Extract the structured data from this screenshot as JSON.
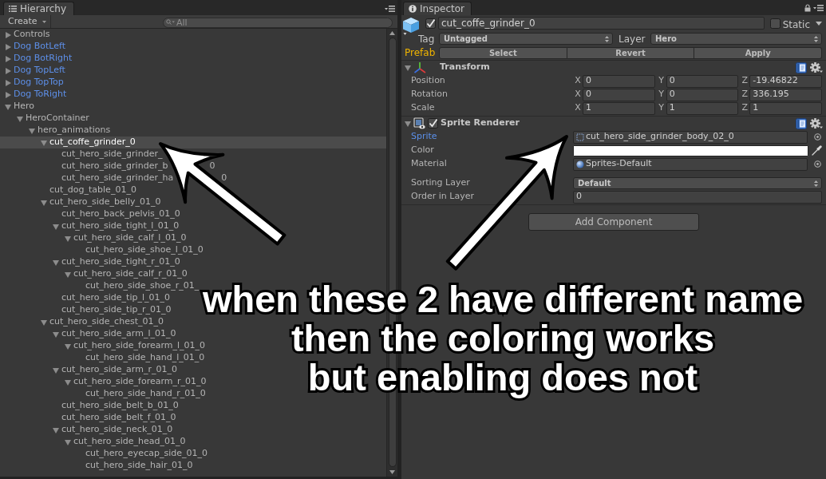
{
  "hierarchy": {
    "tab": "Hierarchy",
    "create_button": "Create",
    "search": {
      "placeholder": "All"
    },
    "items": [
      {
        "label": "Controls",
        "expanded": false,
        "prefab": false,
        "selected": false
      },
      {
        "label": "Dog BotLeft",
        "expanded": false,
        "prefab": true,
        "selected": false
      },
      {
        "label": "Dog BotRight",
        "expanded": false,
        "prefab": true,
        "selected": false
      },
      {
        "label": "Dog TopLeft",
        "expanded": false,
        "prefab": true,
        "selected": false
      },
      {
        "label": "Dog TopTop",
        "expanded": false,
        "prefab": true,
        "selected": false
      },
      {
        "label": "Dog ToRight",
        "expanded": false,
        "prefab": true,
        "selected": false
      },
      {
        "label": "Hero",
        "expanded": true,
        "prefab": false,
        "selected": false,
        "children": [
          {
            "label": "HeroContainer",
            "expanded": true,
            "selected": false,
            "children": [
              {
                "label": "hero_animations",
                "expanded": true,
                "selected": false,
                "children": [
                  {
                    "label": "cut_coffe_grinder_0",
                    "expanded": true,
                    "selected": true,
                    "children": [
                      {
                        "label": "cut_hero_side_grinder_",
                        "selected": false
                      },
                      {
                        "label": "cut_hero_side_grinder_b",
                        "text_after_arrow": "0",
                        "selected": false
                      },
                      {
                        "label": "cut_hero_side_grinder_ha",
                        "text_after_arrow": "0",
                        "selected": false
                      }
                    ]
                  },
                  {
                    "label": "cut_dog_table_01_0",
                    "selected": false
                  },
                  {
                    "label": "cut_hero_side_belly_01_0",
                    "expanded": true,
                    "selected": false,
                    "children": [
                      {
                        "label": "cut_hero_back_pelvis_01_0",
                        "selected": false
                      },
                      {
                        "label": "cut_hero_side_tight_l_01_0",
                        "expanded": true,
                        "selected": false,
                        "children": [
                          {
                            "label": "cut_hero_side_calf_l_01_0",
                            "expanded": true,
                            "selected": false,
                            "children": [
                              {
                                "label": "cut_hero_side_shoe_l_01_0",
                                "selected": false
                              }
                            ]
                          }
                        ]
                      },
                      {
                        "label": "cut_hero_side_tight_r_01_0",
                        "expanded": true,
                        "selected": false,
                        "children": [
                          {
                            "label": "cut_hero_side_calf_r_01_0",
                            "expanded": true,
                            "selected": false,
                            "children": [
                              {
                                "label": "cut_hero_side_shoe_r_01_",
                                "selected": false
                              }
                            ]
                          }
                        ]
                      },
                      {
                        "label": "cut_hero_side_tip_l_01_0",
                        "selected": false
                      },
                      {
                        "label": "cut_hero_side_tip_r_01_0",
                        "selected": false
                      }
                    ]
                  },
                  {
                    "label": "cut_hero_side_chest_01_0",
                    "expanded": true,
                    "selected": false,
                    "children": [
                      {
                        "label": "cut_hero_side_arm_l_01_0",
                        "expanded": true,
                        "selected": false,
                        "children": [
                          {
                            "label": "cut_hero_side_forearm_l_01_0",
                            "expanded": true,
                            "selected": false,
                            "children": [
                              {
                                "label": "cut_hero_side_hand_l_01_0",
                                "selected": false
                              }
                            ]
                          }
                        ]
                      },
                      {
                        "label": "cut_hero_side_arm_r_01_0",
                        "expanded": true,
                        "selected": false,
                        "children": [
                          {
                            "label": "cut_hero_side_forearm_r_01_0",
                            "expanded": true,
                            "selected": false,
                            "children": [
                              {
                                "label": "cut_hero_side_hand_r_01_0",
                                "selected": false
                              }
                            ]
                          }
                        ]
                      },
                      {
                        "label": "cut_hero_side_belt_b_01_0",
                        "selected": false
                      },
                      {
                        "label": "cut_hero_side_belt_f_01_0",
                        "selected": false
                      },
                      {
                        "label": "cut_hero_side_neck_01_0",
                        "expanded": true,
                        "selected": false,
                        "children": [
                          {
                            "label": "cut_hero_side_head_01_0",
                            "expanded": true,
                            "selected": false,
                            "children": [
                              {
                                "label": "cut_hero_eyecap_side_01_0",
                                "selected": false
                              },
                              {
                                "label": "cut_hero_side_hair_01_0",
                                "selected": false
                              }
                            ]
                          }
                        ]
                      }
                    ]
                  }
                ]
              }
            ]
          }
        ]
      }
    ]
  },
  "inspector": {
    "tab": "Inspector",
    "object": {
      "active": true,
      "name": "cut_coffe_grinder_0",
      "static": false,
      "static_label": "Static"
    },
    "tag": {
      "label": "Tag",
      "value": "Untagged"
    },
    "layer": {
      "label": "Layer",
      "value": "Hero"
    },
    "prefab": {
      "label": "Prefab",
      "buttons": [
        "Select",
        "Revert",
        "Apply"
      ]
    },
    "components": [
      {
        "kind": "transform",
        "title": "Transform",
        "expanded": true,
        "rows": [
          {
            "label": "Position",
            "fields": [
              {
                "axis": "X",
                "value": "0"
              },
              {
                "axis": "Y",
                "value": "0"
              },
              {
                "axis": "Z",
                "value": "-19.46822"
              }
            ]
          },
          {
            "label": "Rotation",
            "fields": [
              {
                "axis": "X",
                "value": "0"
              },
              {
                "axis": "Y",
                "value": "0"
              },
              {
                "axis": "Z",
                "value": "336.195"
              }
            ]
          },
          {
            "label": "Scale",
            "fields": [
              {
                "axis": "X",
                "value": "1"
              },
              {
                "axis": "Y",
                "value": "1"
              },
              {
                "axis": "Z",
                "value": "1"
              }
            ]
          }
        ]
      },
      {
        "kind": "sprite_renderer",
        "title": "Sprite Renderer",
        "expanded": true,
        "enabled": true,
        "properties": [
          {
            "kind": "sprite",
            "label": "Sprite",
            "value": "cut_hero_side_grinder_body_02_0",
            "focused": true
          },
          {
            "kind": "color",
            "label": "Color",
            "color": "#ffffff",
            "focused": false
          },
          {
            "kind": "material",
            "label": "Material",
            "value": "Sprites-Default",
            "focused": false
          },
          {
            "kind": "dropdown",
            "label": "Sorting Layer",
            "value": "Default",
            "focused": false
          },
          {
            "kind": "number",
            "label": "Order in Layer",
            "value": "0",
            "focused": false
          }
        ]
      }
    ],
    "add_component": "Add Component"
  },
  "annotation": {
    "lines": [
      "when these 2 have different name",
      "then the coloring works",
      "but enabling does not"
    ]
  }
}
